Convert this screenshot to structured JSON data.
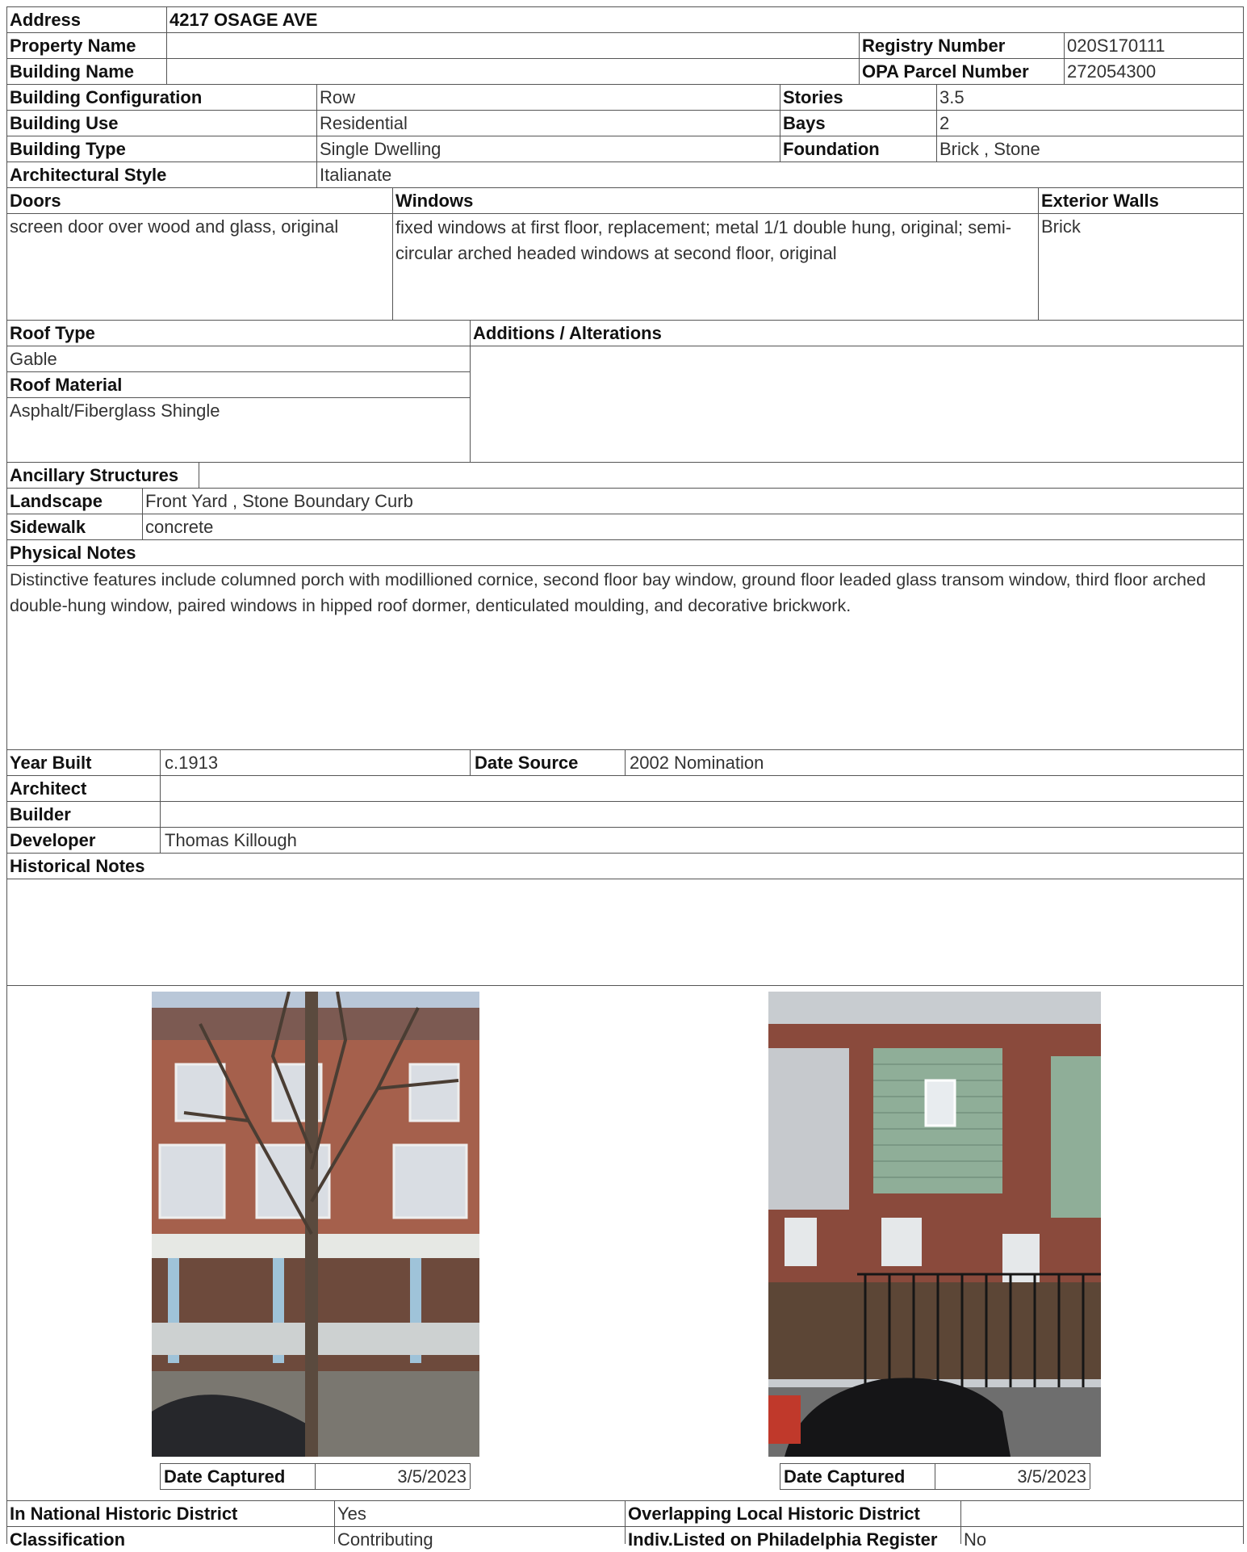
{
  "top": {
    "address_label": "Address",
    "address": "4217 OSAGE AVE",
    "property_name_label": "Property Name",
    "property_name": "",
    "building_name_label": "Building Name",
    "building_name": "",
    "registry_number_label": "Registry Number",
    "registry_number": "020S170111",
    "opa_label": "OPA Parcel Number",
    "opa_number": "272054300"
  },
  "building": {
    "configuration_label": "Building Configuration",
    "configuration": "Row",
    "use_label": "Building Use",
    "use": "Residential",
    "type_label": "Building Type",
    "type": "Single Dwelling",
    "style_label": "Architectural Style",
    "style": "Italianate",
    "stories_label": "Stories",
    "stories": "3.5",
    "bays_label": "Bays",
    "bays": "2",
    "foundation_label": "Foundation",
    "foundation": "Brick , Stone"
  },
  "features": {
    "doors_label": "Doors",
    "doors": "screen door over wood and glass, original",
    "windows_label": "Windows",
    "windows": "fixed windows at first floor, replacement; metal 1/1 double hung, original; semi-circular arched headed windows at second floor, original",
    "exterior_walls_label": "Exterior Walls",
    "exterior_walls": "Brick",
    "roof_type_label": "Roof Type",
    "roof_type": "Gable",
    "roof_material_label": "Roof Material",
    "roof_material": "Asphalt/Fiberglass Shingle",
    "additions_label": "Additions / Alterations",
    "additions": ""
  },
  "site": {
    "ancillary_label": "Ancillary Structures",
    "ancillary": "",
    "landscape_label": "Landscape",
    "landscape": "Front Yard , Stone Boundary Curb",
    "sidewalk_label": "Sidewalk",
    "sidewalk": "concrete",
    "physical_notes_label": "Physical Notes",
    "physical_notes": "Distinctive features include columned porch with modillioned cornice, second floor bay window, ground floor leaded glass transom window, third floor arched double-hung window, paired windows in hipped roof dormer, denticulated moulding, and decorative brickwork."
  },
  "history": {
    "year_built_label": "Year Built",
    "year_built": "c.1913",
    "date_source_label": "Date Source",
    "date_source": "2002 Nomination",
    "architect_label": "Architect",
    "architect": "",
    "builder_label": "Builder",
    "builder": "",
    "developer_label": "Developer",
    "developer": "Thomas Killough",
    "historical_notes_label": "Historical Notes",
    "historical_notes": ""
  },
  "photos": [
    {
      "date_label": "Date Captured",
      "date": "3/5/2023",
      "icon": "front-facade-photo"
    },
    {
      "date_label": "Date Captured",
      "date": "3/5/2023",
      "icon": "rear-facade-photo"
    }
  ],
  "status": {
    "national_district_label": "In National Historic District",
    "national_district": "Yes",
    "overlapping_label": "Overlapping Local Historic District",
    "overlapping": "",
    "classification_label": "Classification",
    "classification": "Contributing",
    "indiv_label": "Indiv.Listed on Philadelphia Register",
    "indiv": "No"
  }
}
